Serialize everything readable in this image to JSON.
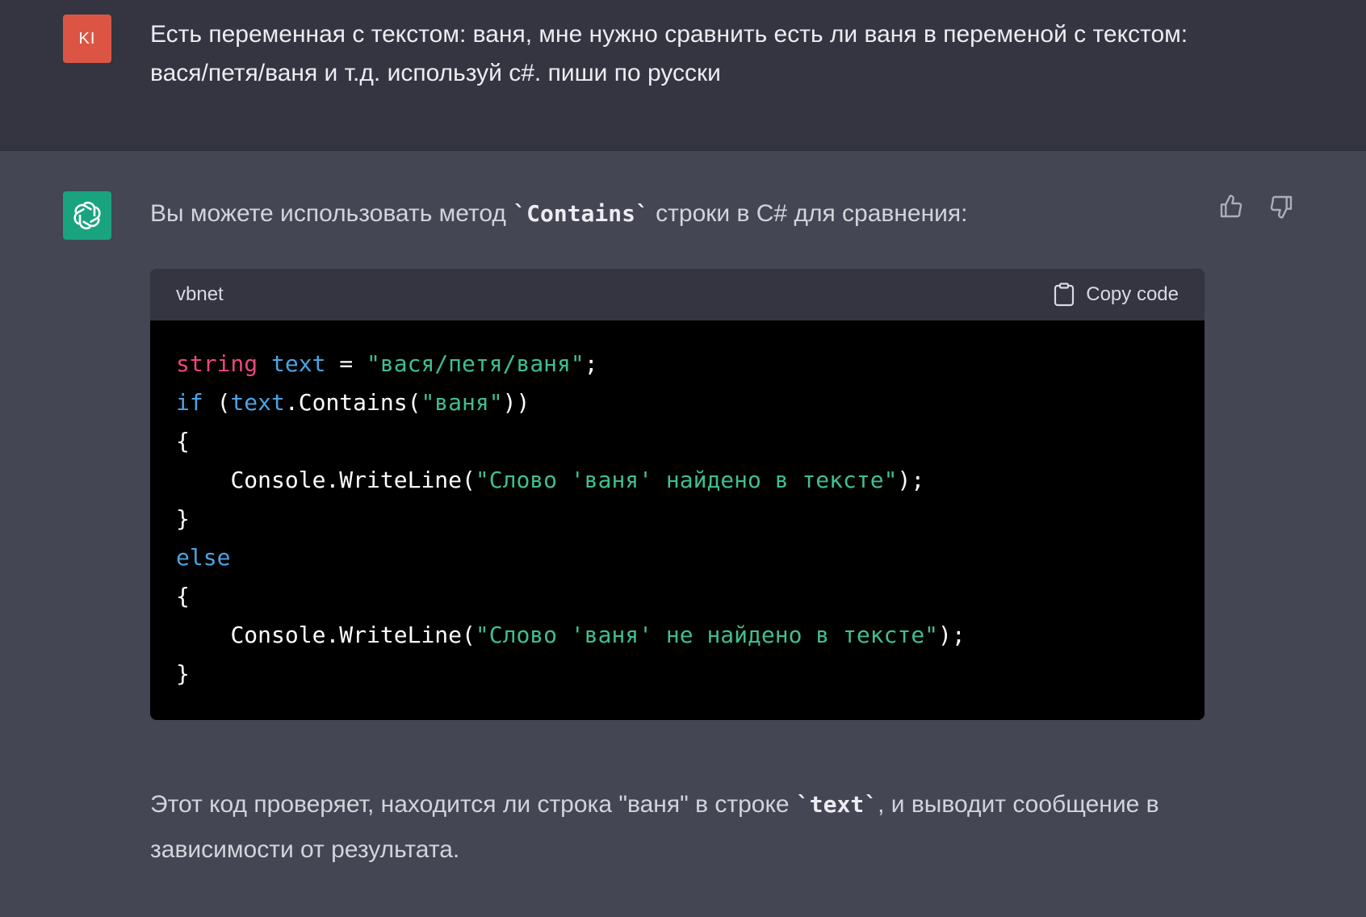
{
  "user_message": {
    "avatar_initials": "KI",
    "text": "Есть переменная с текстом: ваня, мне нужно сравнить есть ли ваня в переменой с текстом: вася/петя/ваня и т.д. используй c#. пиши по русски"
  },
  "assistant_message": {
    "intro_before": "Вы можете использовать метод ",
    "intro_code": "`Contains`",
    "intro_after": " строки в C# для сравнения:",
    "code_block": {
      "language": "vbnet",
      "copy_label": "Copy code",
      "lines": {
        "l1": {
          "t1": "string",
          "t2": " ",
          "t3": "text",
          "t4": " = ",
          "t5": "\"вася/петя/ваня\"",
          "t6": ";"
        },
        "l2": {
          "t1": "if",
          "t2": " (",
          "t3": "text",
          "t4": ".Contains(",
          "t5": "\"ваня\"",
          "t6": "))"
        },
        "l3": "{",
        "l4": {
          "indent": "    ",
          "t1": "Console.WriteLine(",
          "t2": "\"Слово 'ваня' найдено в тексте\"",
          "t3": ");"
        },
        "l5": "}",
        "l6": "else",
        "l7": "{",
        "l8": {
          "indent": "    ",
          "t1": "Console.WriteLine(",
          "t2": "\"Слово 'ваня' не найдено в тексте\"",
          "t3": ");"
        },
        "l9": "}"
      }
    },
    "outro_before": "Этот код проверяет, находится ли строка \"ваня\" в строке ",
    "outro_code": "`text`",
    "outro_after": ", и выводит сообщение в зависимости от результата."
  },
  "colors": {
    "user_bg": "#343541",
    "assistant_bg": "#444654",
    "user_avatar": "#dc5544",
    "bot_avatar": "#19a37f",
    "code_bg": "#000000",
    "keyword_type": "#e9487b",
    "keyword": "#4ba3e3",
    "string": "#3fbf8f"
  },
  "icons": [
    "openai-logo-icon",
    "thumbs-up-icon",
    "thumbs-down-icon",
    "clipboard-icon"
  ]
}
